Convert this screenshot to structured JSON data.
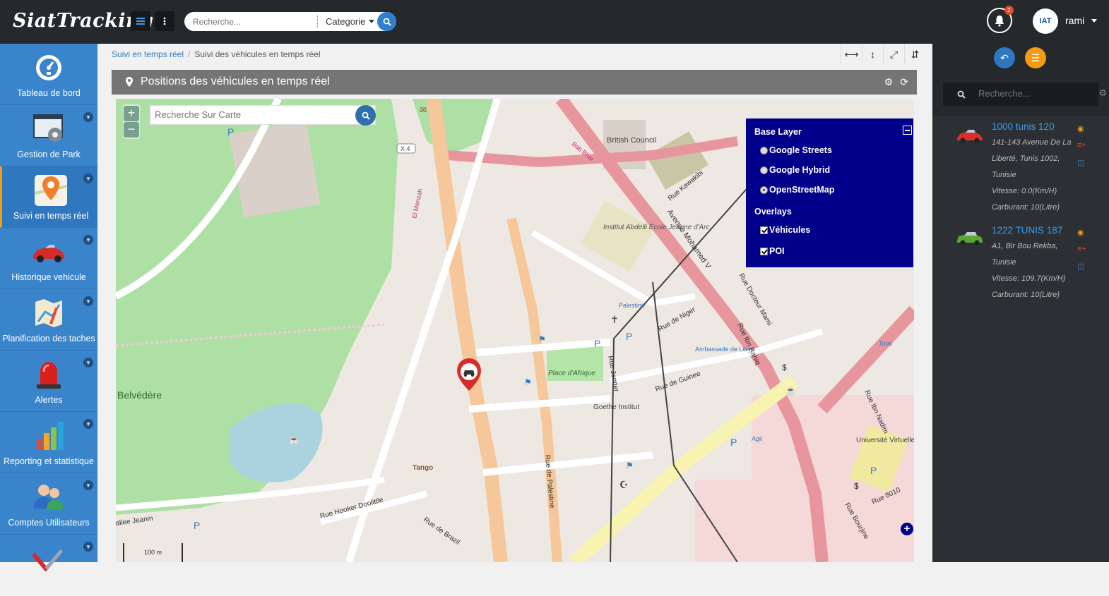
{
  "app": {
    "title": "SiatTracking"
  },
  "topbar": {
    "search_placeholder": "Recherche...",
    "category_label": "Categorie",
    "notifications_count": "2",
    "avatar_text": "IAT",
    "username": "rami"
  },
  "sidebar": {
    "items": [
      {
        "label": "Tableau de bord",
        "icon": "dashboard-icon"
      },
      {
        "label": "Gestion de Park",
        "icon": "settings-window-icon"
      },
      {
        "label": "Suivi en temps réel",
        "icon": "map-pin-icon"
      },
      {
        "label": "Historique vehicule",
        "icon": "car-icon"
      },
      {
        "label": "Planification des taches",
        "icon": "map-plan-icon"
      },
      {
        "label": "Alertes",
        "icon": "siren-icon"
      },
      {
        "label": "Reporting et statistique",
        "icon": "bar-chart-icon"
      },
      {
        "label": "Comptes Utilisateurs",
        "icon": "users-icon"
      },
      {
        "label": "",
        "icon": "tools-icon"
      }
    ]
  },
  "breadcrumb": {
    "root": "Suivi en temps réel",
    "current": "Suivi des véhicules en temps réel"
  },
  "panel": {
    "title": "Positions des véhicules en temps réel"
  },
  "map": {
    "search_placeholder": "Recherche Sur Carte",
    "zoom_in": "+",
    "zoom_out": "−",
    "scale_label": "100 m",
    "labels": {
      "british_council": "British Council",
      "institut": "Institut Abdelli École Jeanne d'Arc",
      "place_afrique": "Place d'Afrique",
      "goethe": "Goethe Institut",
      "belvedere": "Belvédère",
      "tango": "Tango",
      "universite": "Université Virtuelle de Tunis",
      "ambassade": "Ambassade de Libye",
      "palestine": "Palestine",
      "total": "Total",
      "agil": "Agil",
      "av_mohamed_v": "Avenue Mohamed V",
      "rue_kawakibi": "Rue Kawakibi",
      "rue_hooker": "Rue Hooker Doolittle",
      "rue_brazil": "Rue de Brazil",
      "rue_guinee": "Rue de Guinee",
      "rue_niger": "Rue de Niger",
      "rue_jenner": "Rue Jenner",
      "rue_palestine": "Rue de Palestine",
      "rue_docteur": "Rue Docteur Mami",
      "rue_ibn_rahiq": "Rue Ibn Rahiq",
      "rue_ibn_nadim": "Rue Ibn Nadim",
      "rue_8010": "Rue 8010",
      "rue_bourjine": "Rue Bourjine",
      "allee_jeanin": "allee Jeanin",
      "el_menzah": "El Menzah",
      "bab_bhar": "Bab Bhar",
      "x4": "X 4"
    },
    "layer_switcher": {
      "base_layer_title": "Base Layer",
      "base_layers": [
        "Google Streets",
        "Google Hybrid",
        "OpenStreetMap"
      ],
      "selected_base": "OpenStreetMap",
      "overlays_title": "Overlays",
      "overlays": [
        "Véhicules",
        "POI"
      ]
    }
  },
  "right_panel": {
    "search_placeholder": "Recherche...",
    "vehicles": [
      {
        "name": "1000 tunis 120",
        "address": "141-143 Avenue De La Liberté, Tunis 1002, Tunisie",
        "address_lines": [
          "141-143 Avenue De La",
          "Liberté, Tunis 1002,",
          "Tunisie"
        ],
        "speed": "Vitesse: 0.0(Km/H)",
        "fuel": "Carburant: 10(Litre)",
        "color": "#d9302c"
      },
      {
        "name": "1222 TUNIS 187",
        "address": "A1, Bir Bou Rekba, Tunisie",
        "address_lines": [
          "A1, Bir Bou Rekba,",
          "Tunisie"
        ],
        "speed": "Vitesse: 109.7(Km/H)",
        "fuel": "Carburant: 10(Litre)",
        "color": "#5aa832"
      }
    ]
  },
  "colors": {
    "accent": "#3a84cc",
    "topbar": "#26292c",
    "layer_panel": "#00008b",
    "orange": "#f39c12"
  }
}
